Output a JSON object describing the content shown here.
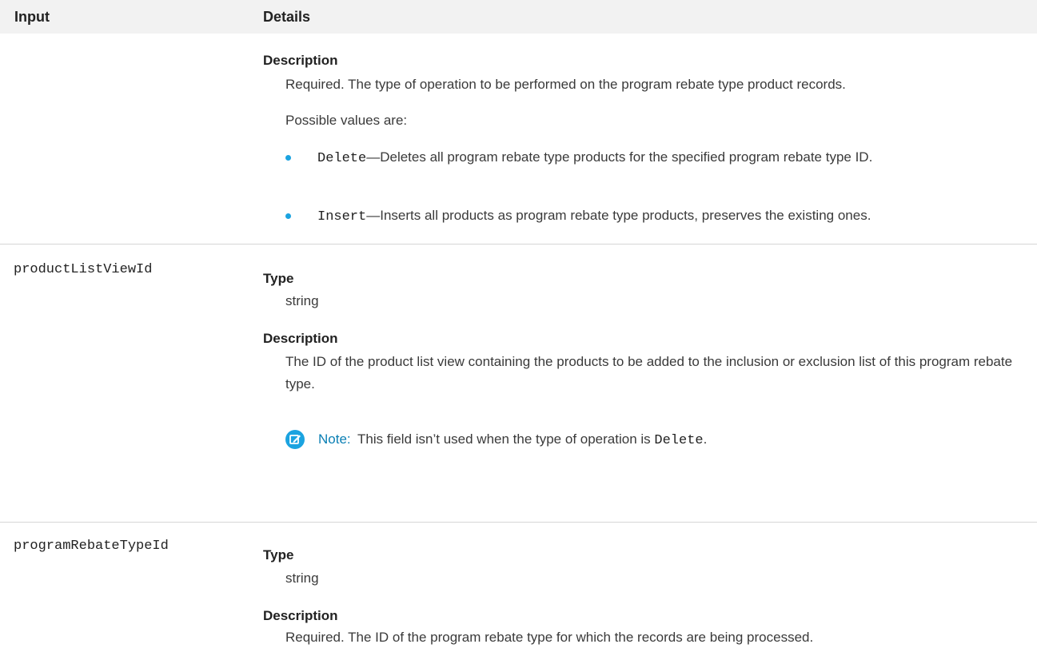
{
  "header": {
    "input_label": "Input",
    "details_label": "Details"
  },
  "rows": [
    {
      "input": "",
      "description_label": "Description",
      "description": "Required. The type of operation to be performed on the program rebate type product records.",
      "possible_values_label": "Possible values are:",
      "values": [
        {
          "code": "Delete",
          "text": "—Deletes all program rebate type products for the specified program rebate type ID."
        },
        {
          "code": "Insert",
          "text": "—Inserts all products as program rebate type products, preserves the existing ones."
        }
      ]
    },
    {
      "input": "productListViewId",
      "type_label": "Type",
      "type": "string",
      "description_label": "Description",
      "description": "The ID of the product list view containing the products to be added to the inclusion or exclusion list of this program rebate type.",
      "note": {
        "label": "Note:",
        "text_before": "This field isn’t used when the type of operation is",
        "code": "Delete",
        "text_after": "."
      }
    },
    {
      "input": "programRebateTypeId",
      "type_label": "Type",
      "type": "string",
      "description_label": "Description",
      "description": "Required. The ID of the program rebate type for which the records are being processed."
    }
  ],
  "colors": {
    "header_bg": "#f2f2f2",
    "bullet": "#1ba3e0",
    "note_accent": "#0a7fb4",
    "rule": "#d6d6d6"
  },
  "icons": {
    "note": "pencil-note-icon"
  }
}
